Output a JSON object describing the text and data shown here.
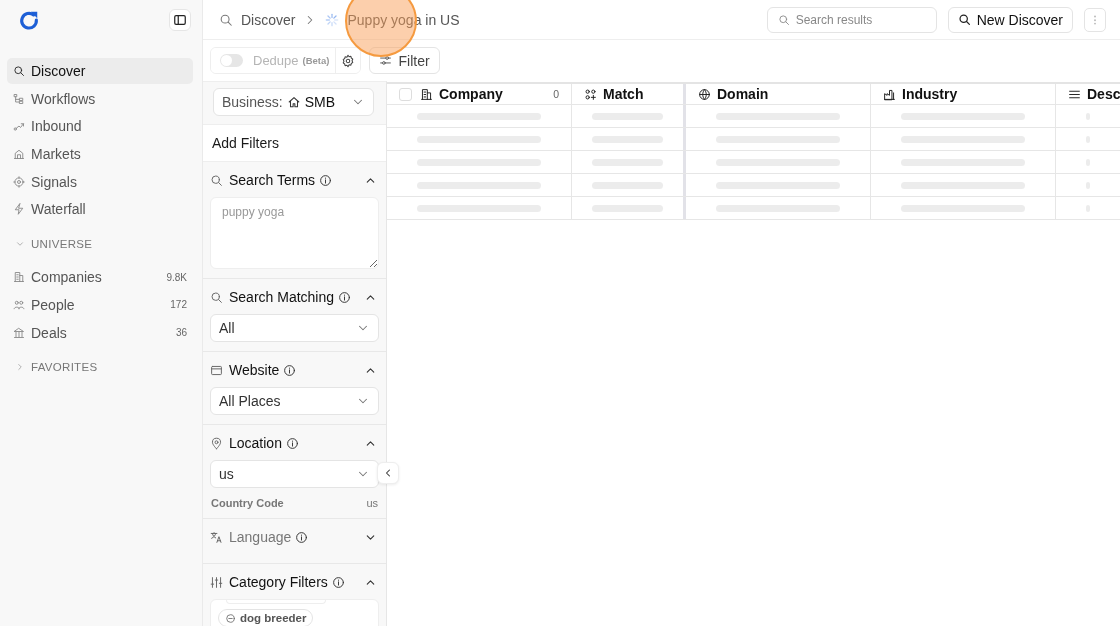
{
  "sidebar": {
    "nav": [
      {
        "label": "Discover",
        "selected": true
      },
      {
        "label": "Workflows",
        "selected": false
      },
      {
        "label": "Inbound",
        "selected": false
      },
      {
        "label": "Markets",
        "selected": false
      },
      {
        "label": "Signals",
        "selected": false
      },
      {
        "label": "Waterfall",
        "selected": false
      }
    ],
    "groups": [
      {
        "title": "UNIVERSE",
        "expanded": true,
        "items": [
          {
            "label": "Companies",
            "count": "9.8K"
          },
          {
            "label": "People",
            "count": "172"
          },
          {
            "label": "Deals",
            "count": "36"
          }
        ]
      },
      {
        "title": "FAVORITES",
        "expanded": false
      }
    ]
  },
  "breadcrumb": {
    "root": "Discover",
    "current": "Puppy yoga in US",
    "loading": true
  },
  "search": {
    "placeholder": "Search results"
  },
  "new_button": "New Discover",
  "toolbar": {
    "dedupe": {
      "label": "Dedupe",
      "tag": "(Beta)",
      "on": false,
      "disabled": true
    },
    "filter_button": "Filter"
  },
  "filters": {
    "business": {
      "label": "Business:",
      "value": "SMB"
    },
    "heading": "Add Filters",
    "sections": [
      {
        "kind": "textarea",
        "title": "Search Terms",
        "info": true,
        "expanded": true,
        "disabled": false,
        "placeholder": "puppy yoga"
      },
      {
        "kind": "select",
        "title": "Search Matching",
        "info": true,
        "expanded": true,
        "disabled": false,
        "value": "All"
      },
      {
        "kind": "select",
        "title": "Website",
        "info": true,
        "expanded": true,
        "disabled": false,
        "value": "All Places"
      },
      {
        "kind": "select",
        "title": "Location",
        "info": true,
        "expanded": true,
        "disabled": false,
        "value": "us",
        "detail": {
          "label": "Country Code",
          "value": "us"
        }
      },
      {
        "kind": "select",
        "title": "Language",
        "info": true,
        "expanded": false,
        "disabled": true
      },
      {
        "kind": "chips",
        "title": "Category Filters",
        "info": true,
        "expanded": true,
        "disabled": false,
        "chips": [
          "dog breeder"
        ]
      }
    ]
  },
  "table": {
    "select_all": {
      "checked": false
    },
    "columns": [
      {
        "label": "Company",
        "count": "0"
      },
      {
        "label": "Match"
      },
      {
        "label": "Domain"
      },
      {
        "label": "Industry"
      },
      {
        "label": "Desc"
      }
    ],
    "rows": [
      {
        "loading": true
      },
      {
        "loading": true
      },
      {
        "loading": true
      },
      {
        "loading": true
      },
      {
        "loading": true
      }
    ]
  }
}
